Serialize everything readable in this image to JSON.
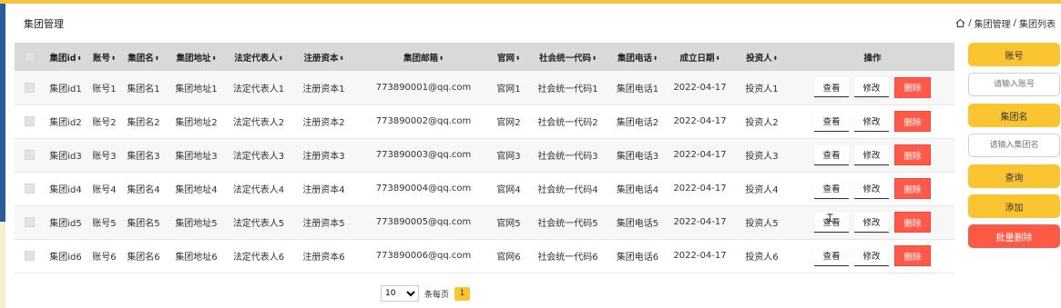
{
  "header": {
    "title": "集团管理",
    "breadcrumb": [
      "集团管理",
      "集团列表"
    ],
    "breadcrumb_sep": "/"
  },
  "table": {
    "columns": [
      "集团id",
      "账号",
      "集团名",
      "集团地址",
      "法定代表人",
      "注册资本",
      "集团邮箱",
      "官网",
      "社会统一代码",
      "集团电话",
      "成立日期",
      "投资人",
      "操作"
    ],
    "sort_icon": "⬍",
    "rows": [
      {
        "id": "集团id1",
        "account": "账号1",
        "name": "集团名1",
        "address": "集团地址1",
        "rep": "法定代表人1",
        "capital": "注册资本1",
        "email": "773890001@qq.com",
        "site": "官网1",
        "code": "社会统一代码1",
        "phone": "集团电话1",
        "date": "2022-04-17",
        "investor": "投资人1"
      },
      {
        "id": "集团id2",
        "account": "账号2",
        "name": "集团名2",
        "address": "集团地址2",
        "rep": "法定代表人2",
        "capital": "注册资本2",
        "email": "773890002@qq.com",
        "site": "官网2",
        "code": "社会统一代码2",
        "phone": "集团电话2",
        "date": "2022-04-17",
        "investor": "投资人2"
      },
      {
        "id": "集团id3",
        "account": "账号3",
        "name": "集团名3",
        "address": "集团地址3",
        "rep": "法定代表人3",
        "capital": "注册资本3",
        "email": "773890003@qq.com",
        "site": "官网3",
        "code": "社会统一代码3",
        "phone": "集团电话3",
        "date": "2022-04-17",
        "investor": "投资人3"
      },
      {
        "id": "集团id4",
        "account": "账号4",
        "name": "集团名4",
        "address": "集团地址4",
        "rep": "法定代表人4",
        "capital": "注册资本4",
        "email": "773890004@qq.com",
        "site": "官网4",
        "code": "社会统一代码4",
        "phone": "集团电话4",
        "date": "2022-04-17",
        "investor": "投资人4"
      },
      {
        "id": "集团id5",
        "account": "账号5",
        "name": "集团名5",
        "address": "集团地址5",
        "rep": "法定代表人5",
        "capital": "注册资本5",
        "email": "773890005@qq.com",
        "site": "官网5",
        "code": "社会统一代码5",
        "phone": "集团电话5",
        "date": "2022-04-17",
        "investor": "投资人5"
      },
      {
        "id": "集团id6",
        "account": "账号6",
        "name": "集团名6",
        "address": "集团地址6",
        "rep": "法定代表人6",
        "capital": "注册资本6",
        "email": "773890006@qq.com",
        "site": "官网6",
        "code": "社会统一代码6",
        "phone": "集团电话6",
        "date": "2022-04-17",
        "investor": "投资人6"
      }
    ],
    "actions": {
      "view": "查看",
      "edit": "修改",
      "delete": "删除"
    }
  },
  "pagination": {
    "page_size": "10",
    "page_size_options": [
      "10"
    ],
    "per_page_label": "条每页",
    "current_page": "1"
  },
  "sidebar": {
    "account_label": "账号",
    "account_placeholder": "请输入账号",
    "name_label": "集团名",
    "name_placeholder": "请输入集团名",
    "search": "查询",
    "add": "添加",
    "batch_delete": "批量删除"
  },
  "colors": {
    "accent": "#fbc531",
    "danger": "#ff5a45",
    "nav": "#2a5b99"
  }
}
